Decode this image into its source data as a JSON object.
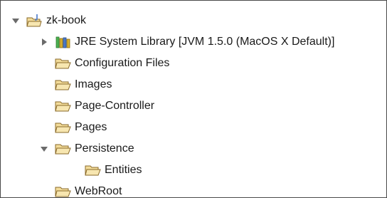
{
  "colors": {
    "folder_fill": "#f3dc9a",
    "folder_stroke": "#8a6a2a",
    "arrow": "#6b6b6b",
    "project_blue": "#4a78c8",
    "library_gold": "#d8b030",
    "library_green": "#4caf50",
    "text": "#1a1a1a"
  },
  "tree": {
    "project": {
      "label": "zk-book",
      "icon": "java-project-icon",
      "expanded": true
    },
    "items": [
      {
        "label": "JRE System Library [JVM 1.5.0 (MacOS X Default)]",
        "icon": "library-icon",
        "expander": "collapsed"
      },
      {
        "label": "Configuration Files",
        "icon": "folder-open-icon",
        "expander": "none"
      },
      {
        "label": "Images",
        "icon": "folder-open-icon",
        "expander": "none"
      },
      {
        "label": "Page-Controller",
        "icon": "folder-open-icon",
        "expander": "none"
      },
      {
        "label": "Pages",
        "icon": "folder-open-icon",
        "expander": "none"
      },
      {
        "label": "Persistence",
        "icon": "folder-open-icon",
        "expander": "expanded"
      },
      {
        "label": "Entities",
        "icon": "folder-open-icon",
        "expander": "none"
      },
      {
        "label": "WebRoot",
        "icon": "folder-open-icon",
        "expander": "none"
      }
    ]
  }
}
